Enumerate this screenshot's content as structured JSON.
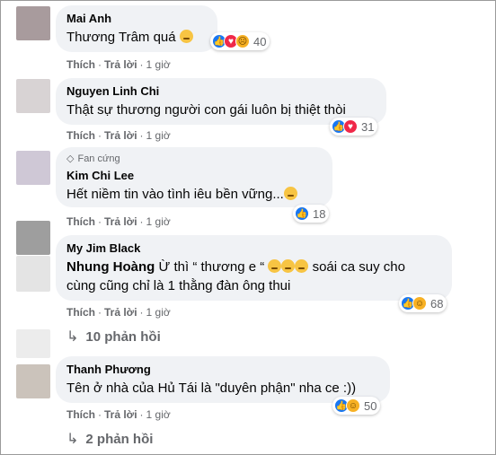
{
  "actions": {
    "like": "Thích",
    "reply": "Trả lời",
    "sep": "·",
    "time": "1 giờ"
  },
  "comments": [
    {
      "name": "Mai Anh",
      "text": "Thương Trâm quá",
      "count": "40"
    },
    {
      "name": "Nguyen Linh Chi",
      "text": "Thật sự thương người con gái luôn bị thiệt thòi",
      "count": "31"
    },
    {
      "badge": "Fan cứng",
      "name": "Kim Chi Lee",
      "text": "Hết niềm tin vào tình iêu bền vững...",
      "count": "18"
    },
    {
      "name": "My Jim Black",
      "mention": "Nhung Hoàng",
      "text1": " Ừ thì “ thương e “",
      "text1b": " soái ca suy cho",
      "text2": "cùng cũng chỉ là 1 thằng đàn ông thui",
      "count": "68",
      "replies": "10 phản hồi"
    },
    {
      "name": "Thanh Phương",
      "text": "Tên ở nhà của Hủ Tái là \"duyên phận\" nha ce :))",
      "count": "50",
      "replies": "2 phản hồi"
    }
  ],
  "colors": {
    "bubble": "#f0f2f5",
    "like": "#1877f2",
    "love": "#f02849",
    "meta": "#65676b"
  }
}
